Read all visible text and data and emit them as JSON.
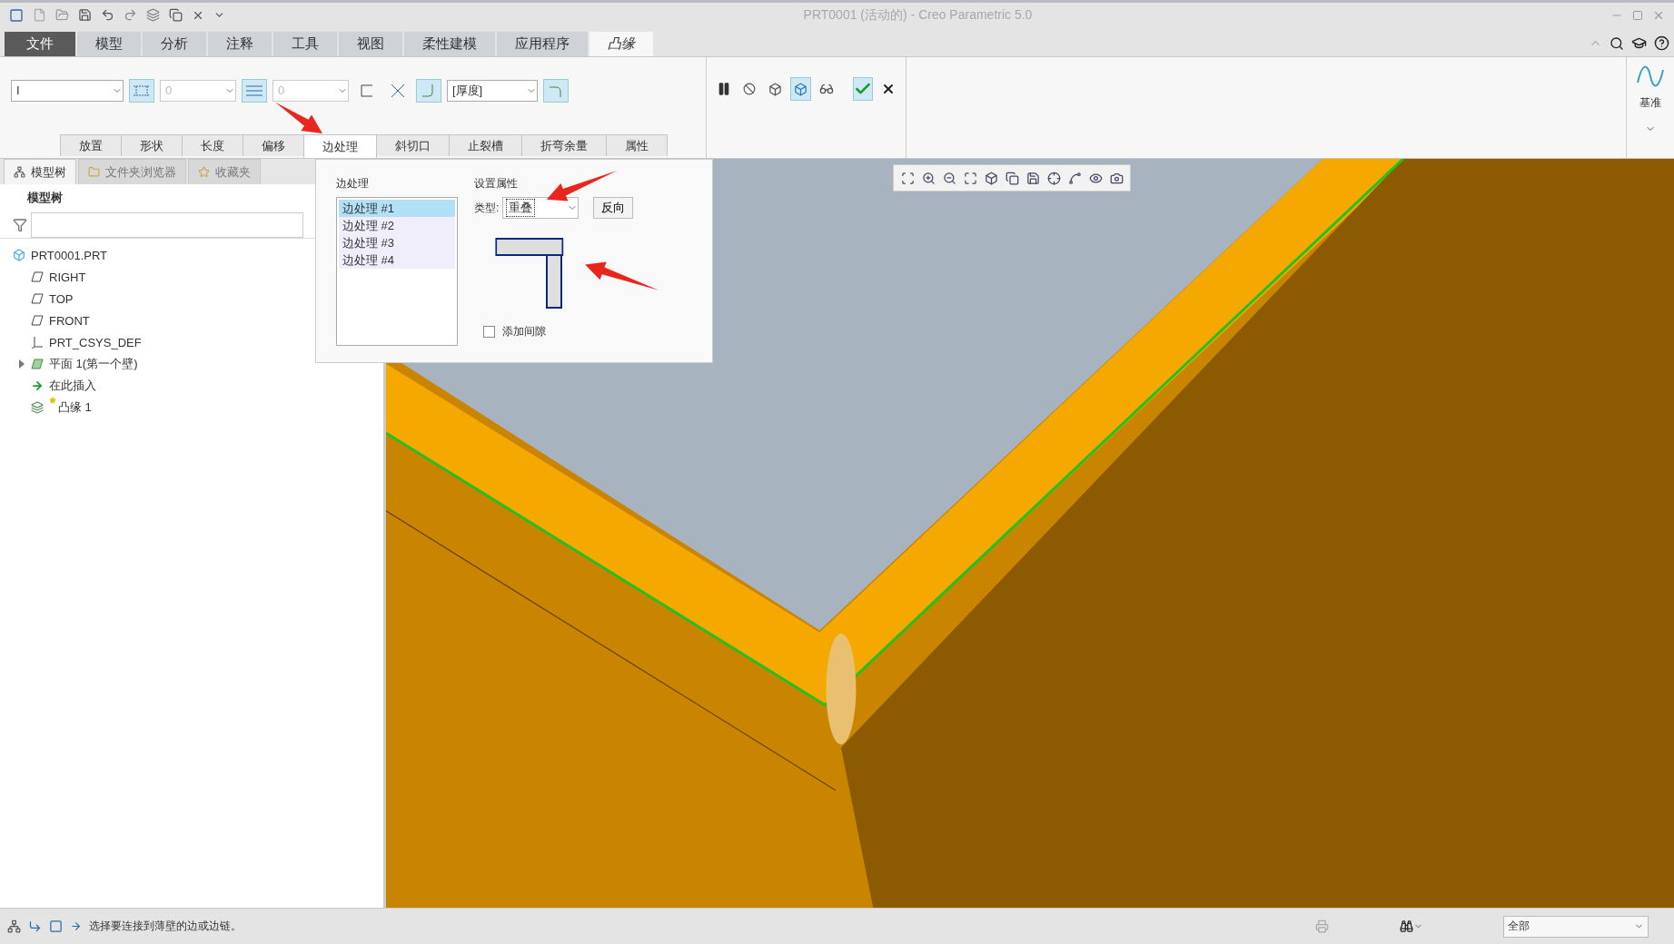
{
  "window": {
    "title": "PRT0001 (活动的) - Creo Parametric 5.0"
  },
  "ribbon_tabs": [
    {
      "label": "文件",
      "kind": "file",
      "selected": false
    },
    {
      "label": "模型",
      "kind": "tab",
      "selected": false
    },
    {
      "label": "分析",
      "kind": "tab",
      "selected": false
    },
    {
      "label": "注释",
      "kind": "tab",
      "selected": false
    },
    {
      "label": "工具",
      "kind": "tab",
      "selected": false
    },
    {
      "label": "视图",
      "kind": "tab",
      "selected": false
    },
    {
      "label": "柔性建模",
      "kind": "tab",
      "selected": false
    },
    {
      "label": "应用程序",
      "kind": "tab",
      "selected": false
    },
    {
      "label": "凸缘",
      "kind": "tab",
      "selected": true
    }
  ],
  "ribbon": {
    "shape_field": {
      "value": "I",
      "disabled": false
    },
    "length_field": {
      "value": "0",
      "disabled": true
    },
    "offset_field": {
      "value": "0",
      "disabled": true
    },
    "thickness_field": {
      "value": "[厚度]",
      "disabled": false
    }
  },
  "datum_group": {
    "label": "基准"
  },
  "sub_tabs": [
    {
      "label": "放置",
      "selected": false
    },
    {
      "label": "形状",
      "selected": false
    },
    {
      "label": "长度",
      "selected": false
    },
    {
      "label": "偏移",
      "selected": false
    },
    {
      "label": "边处理",
      "selected": true
    },
    {
      "label": "斜切口",
      "selected": false
    },
    {
      "label": "止裂槽",
      "selected": false
    },
    {
      "label": "折弯余量",
      "selected": false
    },
    {
      "label": "属性",
      "selected": false
    }
  ],
  "model_tree": {
    "tabs": [
      {
        "label": "模型树",
        "kind": "tree",
        "selected": true
      },
      {
        "label": "文件夹浏览器",
        "kind": "folder",
        "selected": false
      },
      {
        "label": "收藏夹",
        "kind": "favorites",
        "selected": false
      }
    ],
    "heading": "模型树",
    "items": [
      {
        "label": "PRT0001.PRT",
        "kind": "part",
        "children": [
          {
            "label": "RIGHT",
            "kind": "plane"
          },
          {
            "label": "TOP",
            "kind": "plane"
          },
          {
            "label": "FRONT",
            "kind": "plane"
          },
          {
            "label": "PRT_CSYS_DEF",
            "kind": "csys"
          },
          {
            "label": "平面 1(第一个壁)",
            "kind": "wall",
            "expanded": false
          },
          {
            "label": "在此插入",
            "kind": "insert"
          },
          {
            "label": "凸缘 1",
            "kind": "flange",
            "new": true
          }
        ]
      }
    ]
  },
  "edge_treatment_panel": {
    "list_heading": "边处理",
    "items": [
      {
        "label": "边处理 #1",
        "selected": true
      },
      {
        "label": "边处理 #2",
        "selected": false
      },
      {
        "label": "边处理 #3",
        "selected": false
      },
      {
        "label": "边处理 #4",
        "selected": false
      }
    ],
    "properties_heading": "设置属性",
    "type_label": "类型:",
    "type_value": "重叠",
    "flip_button": "反向",
    "add_gap": {
      "label": "添加间隙",
      "checked": false
    }
  },
  "status_bar": {
    "message": "选择要连接到薄壁的边或边链。",
    "filter": "全部"
  }
}
